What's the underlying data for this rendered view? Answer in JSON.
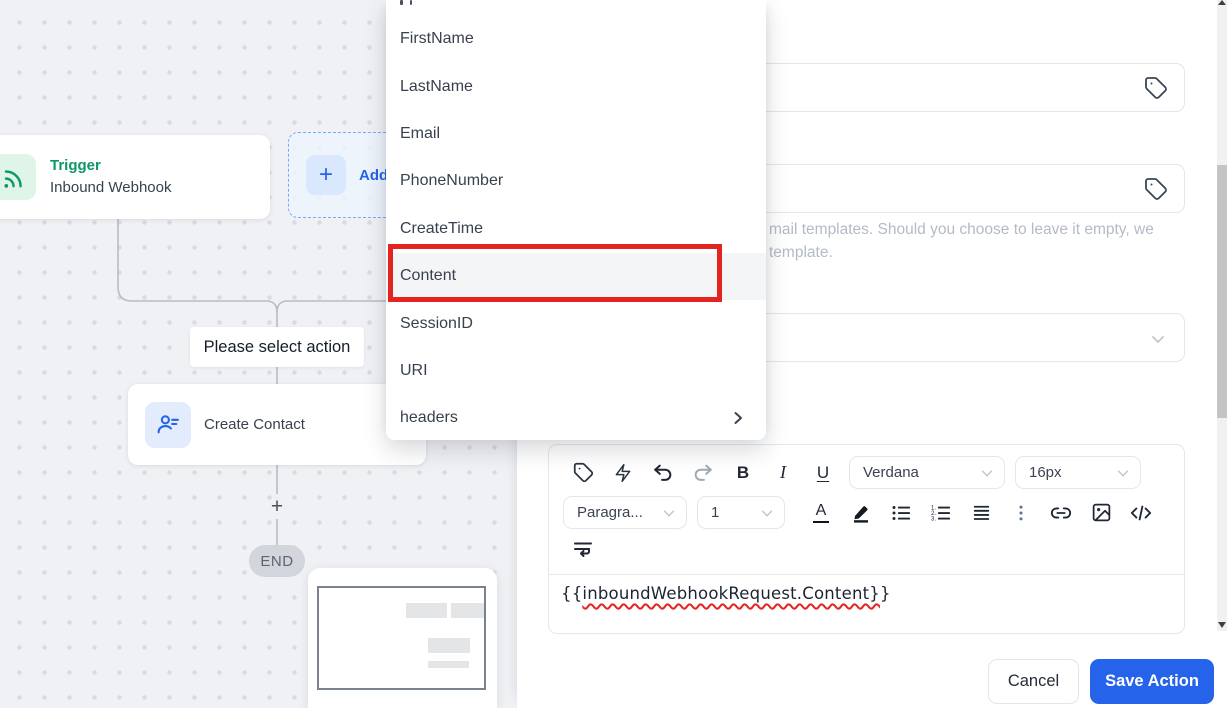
{
  "canvas": {
    "trigger": {
      "title": "Trigger",
      "subtitle": "Inbound Webhook"
    },
    "add_plus": "+",
    "add_label": "Add",
    "select_action_label": "Please select action",
    "create_contact_label": "Create Contact",
    "connector_plus": "+",
    "end_label": "END"
  },
  "dropdown": {
    "items": [
      {
        "label": "FirstName"
      },
      {
        "label": "LastName"
      },
      {
        "label": "Email"
      },
      {
        "label": "PhoneNumber"
      },
      {
        "label": "CreateTime"
      },
      {
        "label": "Content"
      },
      {
        "label": "SessionID"
      },
      {
        "label": "URI"
      },
      {
        "label": "headers"
      }
    ],
    "highlighted_item": "Content",
    "submenu_item": "headers"
  },
  "panel": {
    "helper_line1": "mail templates. Should you choose to leave it empty, we",
    "helper_line2": "template.",
    "editor": {
      "bold": "B",
      "italic": "I",
      "underline": "U",
      "color_letter": "A",
      "font_family_value": "Verdana",
      "font_size_value": "16px",
      "paragraph_value": "Paragra...",
      "line_height_value": "1",
      "content_open": "{{",
      "content_variable": "inboundWebhookRequest.Content}",
      "content_close": "}"
    },
    "cancel_label": "Cancel",
    "save_label": "Save Action"
  },
  "colors": {
    "accent_blue": "#2563eb",
    "trigger_green": "#0d9668",
    "annotation_red": "#e3241f",
    "canvas_background": "#f0f1f4"
  }
}
